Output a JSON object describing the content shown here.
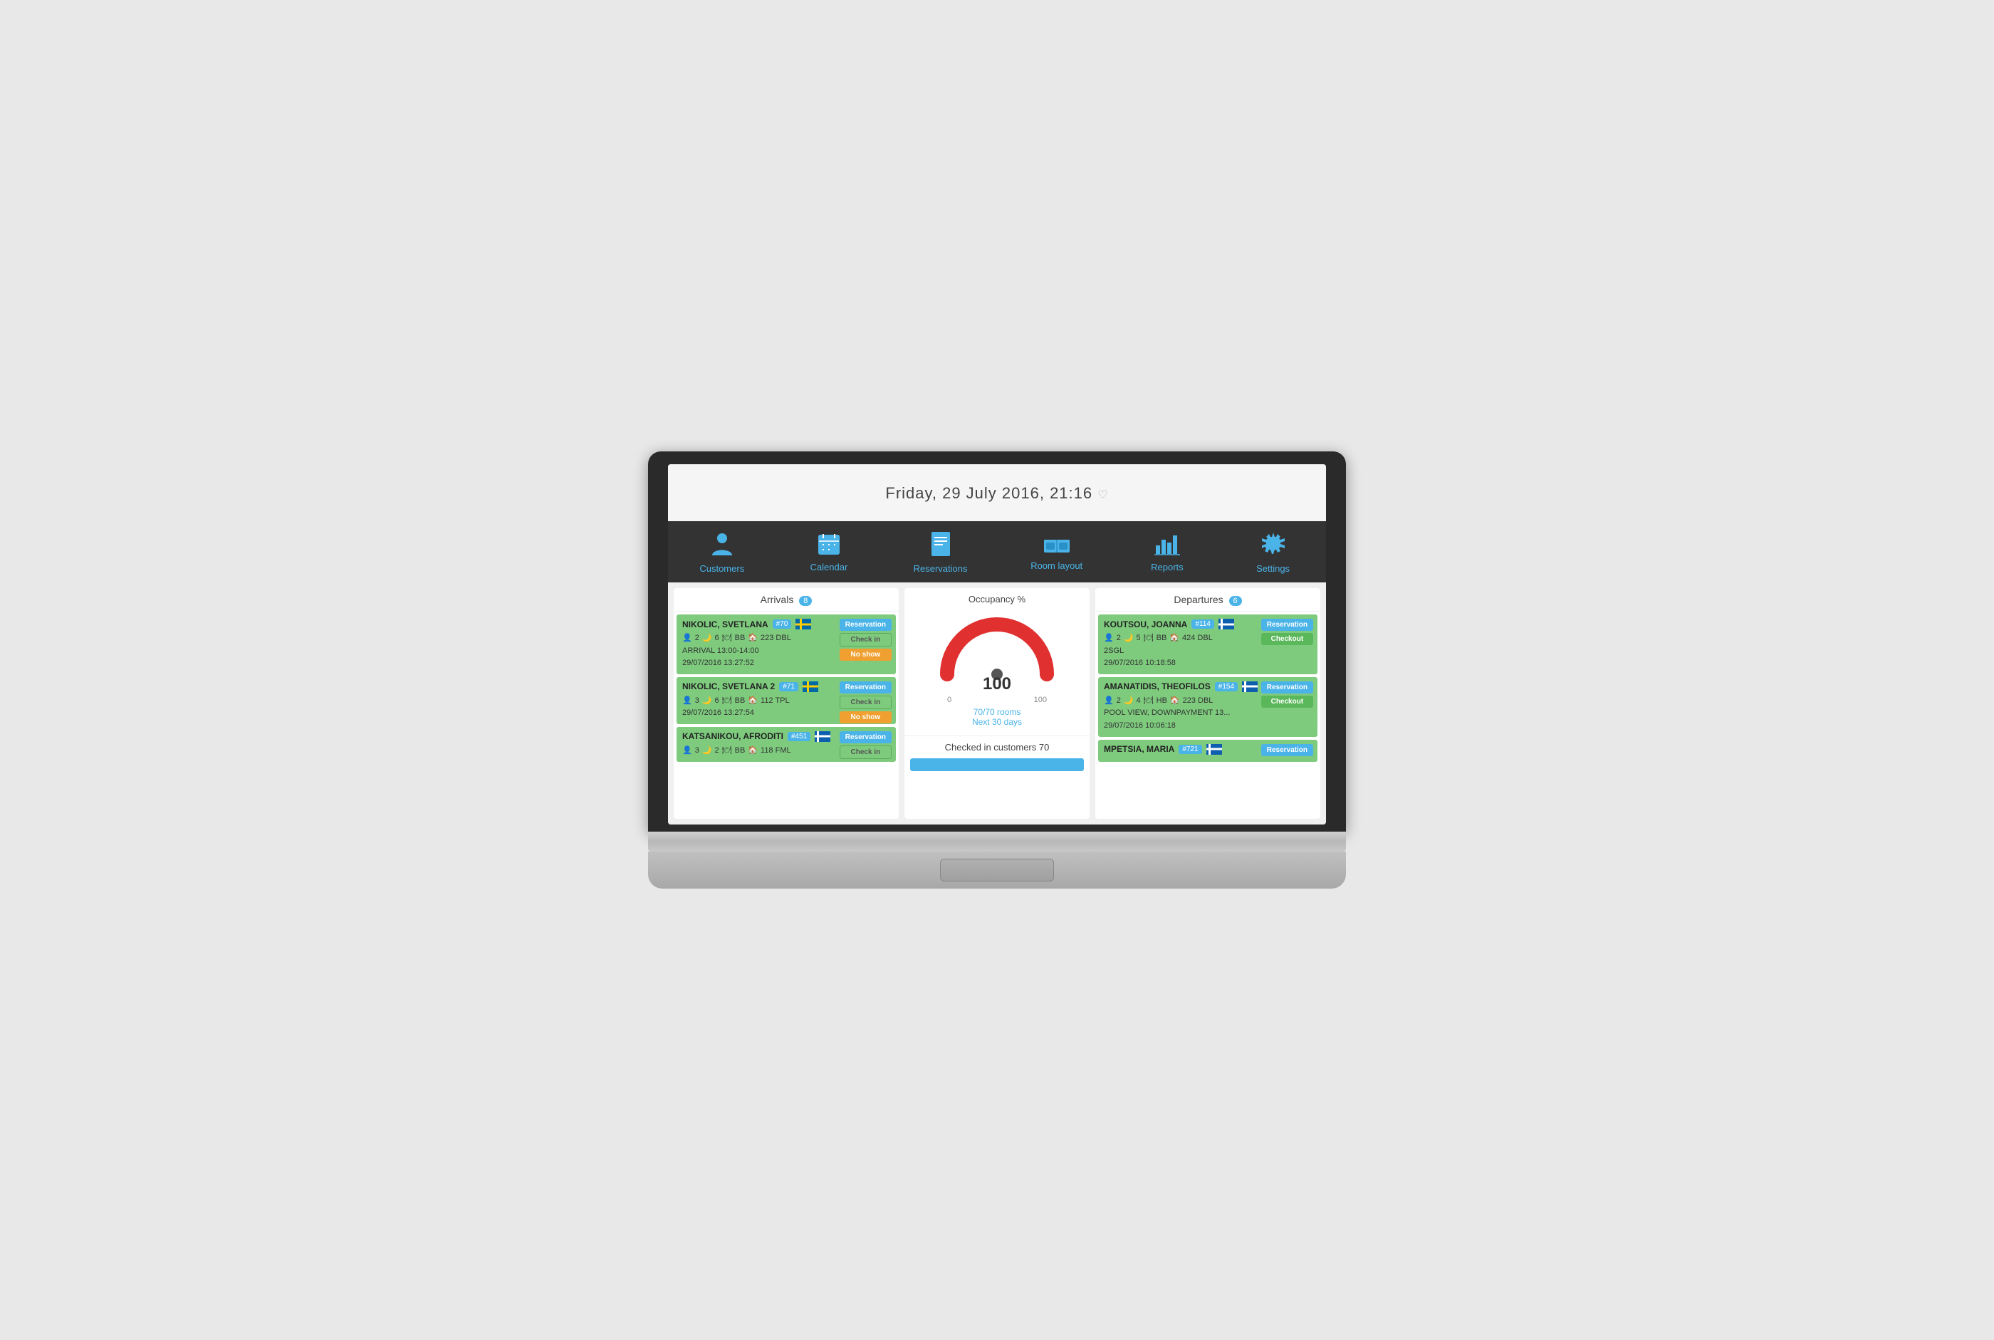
{
  "datetime": "Friday, 29 July 2016, 21:16",
  "nav": {
    "items": [
      {
        "id": "customers",
        "label": "Customers",
        "icon": "👤"
      },
      {
        "id": "calendar",
        "label": "Calendar",
        "icon": "📅"
      },
      {
        "id": "reservations",
        "label": "Reservations",
        "icon": "📄"
      },
      {
        "id": "room_layout",
        "label": "Room layout",
        "icon": "🛏"
      },
      {
        "id": "reports",
        "label": "Reports",
        "icon": "📊"
      },
      {
        "id": "settings",
        "label": "Settings",
        "icon": "⚙"
      }
    ]
  },
  "arrivals": {
    "title": "Arrivals",
    "count": "8",
    "guests": [
      {
        "name": "NIKOLIC, SVETLANA",
        "id": "#70",
        "flag": "se",
        "adults": "2",
        "nights": "6",
        "board": "BB",
        "room": "223 DBL",
        "arrival": "ARRIVAL 13:00-14:00",
        "updated": "29/07/2016 13:27:52",
        "buttons": [
          "Reservation",
          "Check in",
          "No show"
        ]
      },
      {
        "name": "NIKOLIC, SVETLANA 2",
        "id": "#71",
        "flag": "se",
        "adults": "3",
        "nights": "6",
        "board": "BB",
        "room": "112 TPL",
        "arrival": "",
        "updated": "29/07/2016 13:27:54",
        "buttons": [
          "Reservation",
          "Check in",
          "No show"
        ]
      },
      {
        "name": "KATSANIKOU, AFRODITI",
        "id": "#451",
        "flag": "gr",
        "adults": "3",
        "nights": "2",
        "board": "BB",
        "room": "118 FML",
        "arrival": "",
        "updated": "",
        "buttons": [
          "Reservation",
          "Check in"
        ]
      }
    ]
  },
  "occupancy": {
    "title": "Occupancy %",
    "value": "100",
    "min": "0",
    "max": "100",
    "rooms_text": "70/70 rooms",
    "next_days": "Next 30 days"
  },
  "checked_in": {
    "title": "Checked in customers",
    "count": "70",
    "progress": 100
  },
  "departures": {
    "title": "Departures",
    "count": "6",
    "guests": [
      {
        "name": "KOUTSOU, JOANNA",
        "id": "#114",
        "flag": "gr",
        "adults": "2",
        "nights": "5",
        "board": "BB",
        "room": "424 DBL",
        "note": "2SGL",
        "updated": "29/07/2016 10:18:58",
        "buttons": [
          "Reservation",
          "Checkout"
        ]
      },
      {
        "name": "AMANATIDIS, THEOFILOS",
        "id": "#154",
        "flag": "gr",
        "adults": "2",
        "nights": "4",
        "board": "HB",
        "room": "223 DBL",
        "note": "POOL VIEW, DOWNPAYMENT 13...",
        "updated": "29/07/2016 10:06:18",
        "buttons": [
          "Reservation",
          "Checkout"
        ]
      },
      {
        "name": "MPETSIA, MARIA",
        "id": "#721",
        "flag": "gr",
        "adults": "",
        "nights": "",
        "board": "",
        "room": "",
        "note": "",
        "updated": "",
        "buttons": [
          "Reservation"
        ]
      }
    ]
  }
}
